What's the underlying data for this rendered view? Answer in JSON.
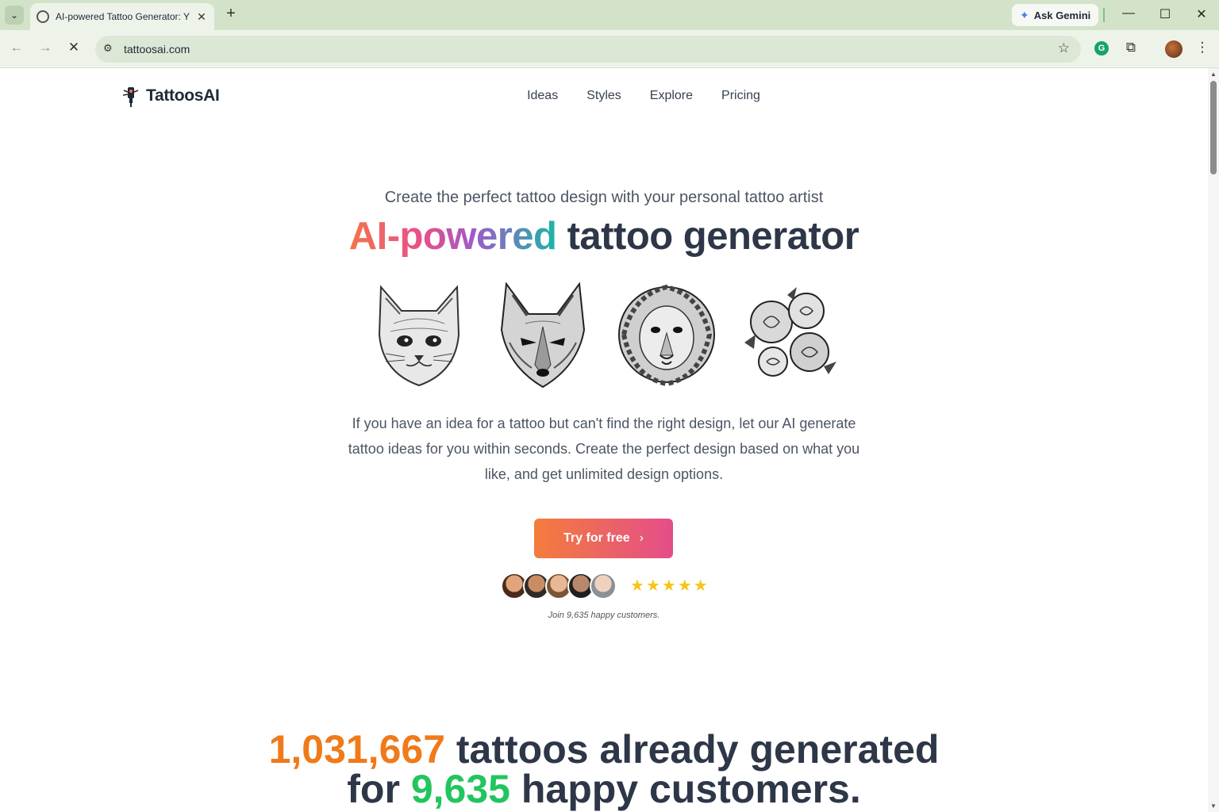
{
  "browser": {
    "tab_title": "AI-powered Tattoo Generator: Y",
    "tab_close": "✕",
    "new_tab": "+",
    "ask_gemini": "Ask Gemini",
    "url": "tattoosai.com",
    "window_controls": {
      "minimize": "—",
      "maximize": "☐",
      "close": "✕"
    },
    "icons": [
      "tab-search-icon",
      "back-icon",
      "forward-icon",
      "stop-icon",
      "site-settings-icon",
      "bookmark-star-icon",
      "grammarly-icon",
      "extensions-icon",
      "profile-avatar",
      "menu-icon"
    ]
  },
  "site": {
    "logo_text": "TattoosAI",
    "nav": [
      "Ideas",
      "Styles",
      "Explore",
      "Pricing"
    ]
  },
  "hero": {
    "subtitle": "Create the perfect tattoo design with your personal tattoo artist",
    "headline_gradient": "AI-powered",
    "headline_rest": "tattoo generator",
    "gallery": [
      "cat",
      "wolf",
      "lion",
      "roses"
    ],
    "intro": "If you have an idea for a tattoo but can't find the right design, let our AI generate tattoo ideas for you within seconds. Create the perfect design based on what you like, and get unlimited design options.",
    "cta_label": "Try for free",
    "cta_chevron": "›",
    "rating_stars": 5,
    "star_glyph": "★",
    "customers_note": "Join 9,635 happy customers."
  },
  "stats": {
    "tattoos_count": "1,031,667",
    "tattoos_text": "tattoos already generated",
    "for_text": "for",
    "customers_count": "9,635",
    "customers_text": "happy customers."
  },
  "colors": {
    "accent_orange": "#f07a1a",
    "accent_green": "#22c55e",
    "cta_start": "#f47c3c",
    "cta_end": "#e44d8a",
    "star": "#f5c518"
  }
}
